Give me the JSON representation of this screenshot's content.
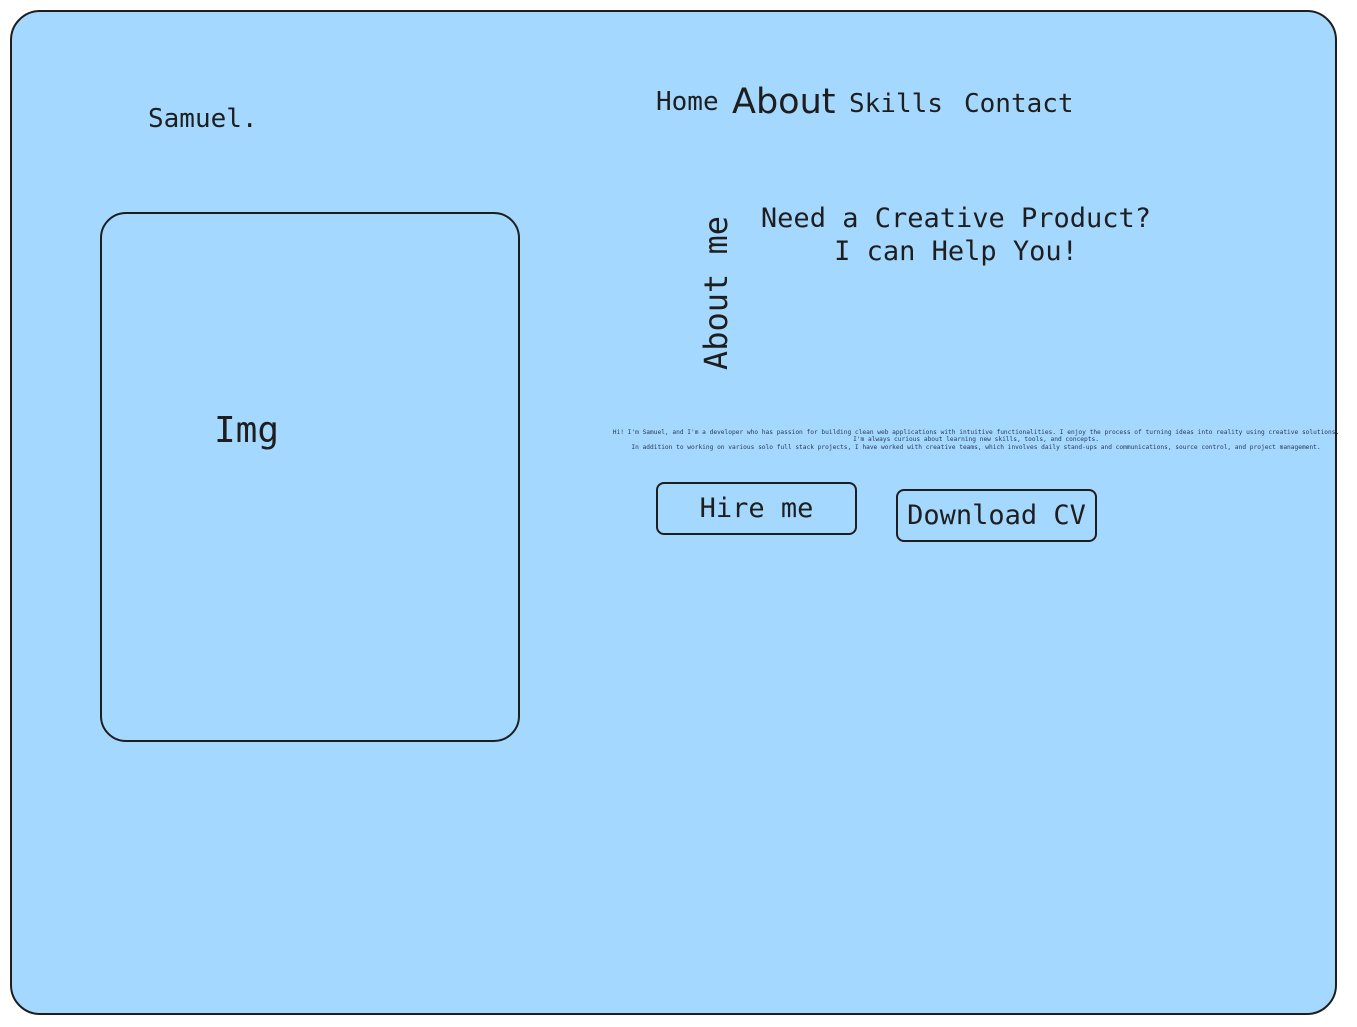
{
  "logo": {
    "text": "Samuel."
  },
  "nav": {
    "home": "Home",
    "about": "About",
    "skills": "Skills",
    "contact": "Contact"
  },
  "image_placeholder": {
    "label": "Img"
  },
  "about": {
    "vertical_title": "About me",
    "headline_line1": "Need a Creative Product?",
    "headline_line2": "I can Help You!",
    "bio_line1": "Hi! I'm Samuel, and I'm a developer who has passion for building clean web applications with intuitive functionalities. I enjoy the process of turning ideas into reality using creative solutions.",
    "bio_line2": "I'm always curious about learning new skills, tools, and concepts.",
    "bio_line3": "In addition to working on various solo full stack projects, I have worked with creative teams, which involves daily stand-ups and communications, source control, and project management."
  },
  "buttons": {
    "hire": "Hire me",
    "download_cv": "Download CV"
  },
  "colors": {
    "background": "#a5d8ff",
    "stroke": "#1e1e1e"
  }
}
